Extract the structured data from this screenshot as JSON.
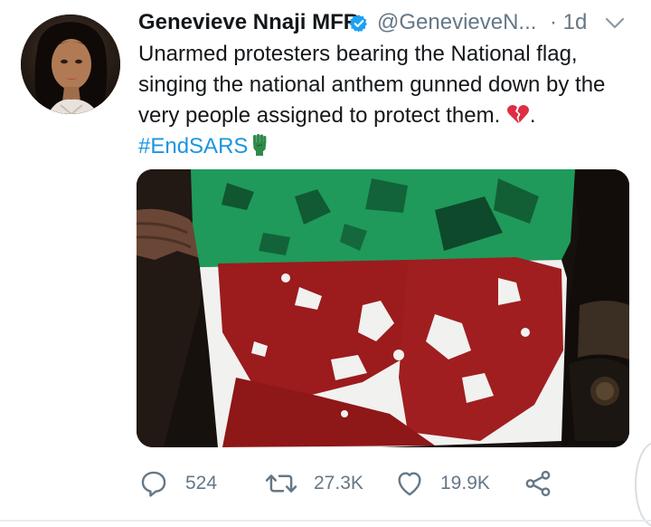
{
  "tweet": {
    "display_name": "Genevieve Nnaji MFR",
    "handle": "@GenevieveN...",
    "separator": "·",
    "timestamp": "1d",
    "text_lines": [
      "Unarmed protesters bearing the National flag,",
      "singing the national anthem gunned down by the",
      "very people assigned to protect them."
    ],
    "text_tail": ".",
    "hashtag": "#EndSARS"
  },
  "actions": {
    "replies": "524",
    "retweets": "27.3K",
    "likes": "19.9K"
  },
  "icons": {
    "avatar": "profile-photo",
    "verified": "verified-badge-icon",
    "menu": "chevron-down-icon",
    "text_emoji": "broken-heart-icon",
    "hashtag_emoji": "raised-fist-icon",
    "reply": "reply-icon",
    "retweet": "retweet-icon",
    "like": "heart-icon",
    "share": "share-icon"
  },
  "colors": {
    "link": "#1b95e0",
    "verified": "#1da1f2",
    "muted": "#657786",
    "broken_heart": "#dd2e44",
    "flag_green": "#1f9a5a",
    "flag_white": "#f4f4f4",
    "blood": "#9c1b1c"
  }
}
